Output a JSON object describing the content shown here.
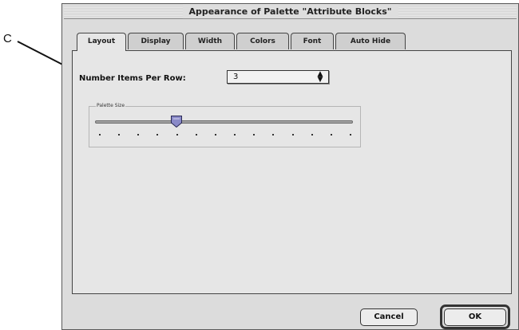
{
  "callout": {
    "letter": "C"
  },
  "window": {
    "title": "Appearance of Palette \"Attribute Blocks\""
  },
  "tabs": [
    {
      "label": "Layout",
      "active": true
    },
    {
      "label": "Display",
      "active": false
    },
    {
      "label": "Width",
      "active": false
    },
    {
      "label": "Colors",
      "active": false
    },
    {
      "label": "Font",
      "active": false
    },
    {
      "label": "Auto Hide",
      "active": false
    }
  ],
  "layout": {
    "items_per_row_label": "Number Items Per Row:",
    "items_per_row_value": "3",
    "palette_size_label": "Palette Size",
    "palette_size_fraction": 0.31,
    "tick_count": 14
  },
  "buttons": {
    "cancel": "Cancel",
    "ok": "OK"
  },
  "colors": {
    "window_bg": "#dcdcdc",
    "pane_bg": "#e6e6e6",
    "thumb": "#8a8ac8"
  }
}
